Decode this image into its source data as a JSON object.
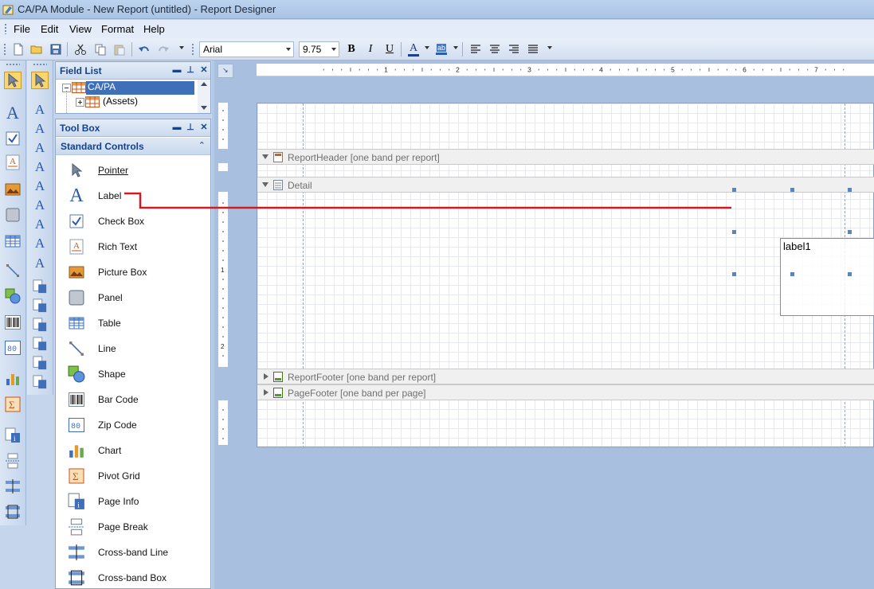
{
  "window": {
    "title": "CA/PA Module - New Report (untitled) - Report Designer"
  },
  "menu": {
    "file": "File",
    "edit": "Edit",
    "view": "View",
    "format": "Format",
    "help": "Help"
  },
  "toolbar": {
    "font_family": "Arial",
    "font_size": "9.75",
    "bold": "B",
    "italic": "I",
    "underline": "U",
    "font_color_glyph": "A",
    "back_color_glyph": "ab"
  },
  "field_list": {
    "title": "Field List",
    "items": [
      {
        "label": "CA/PA",
        "selected": true
      },
      {
        "label": "(Assets)",
        "selected": false
      }
    ]
  },
  "toolbox": {
    "title": "Tool Box",
    "category": "Standard Controls",
    "items": [
      {
        "label": "Pointer",
        "icon": "pointer-icon"
      },
      {
        "label": "Label",
        "icon": "label-icon"
      },
      {
        "label": "Check Box",
        "icon": "checkbox-icon"
      },
      {
        "label": "Rich Text",
        "icon": "rich-text-icon"
      },
      {
        "label": "Picture Box",
        "icon": "picture-icon"
      },
      {
        "label": "Panel",
        "icon": "panel-icon"
      },
      {
        "label": "Table",
        "icon": "table-icon"
      },
      {
        "label": "Line",
        "icon": "line-icon"
      },
      {
        "label": "Shape",
        "icon": "shape-icon"
      },
      {
        "label": "Bar Code",
        "icon": "barcode-icon"
      },
      {
        "label": "Zip Code",
        "icon": "zipcode-icon"
      },
      {
        "label": "Chart",
        "icon": "chart-icon"
      },
      {
        "label": "Pivot Grid",
        "icon": "pivot-grid-icon"
      },
      {
        "label": "Page Info",
        "icon": "page-info-icon"
      },
      {
        "label": "Page Break",
        "icon": "page-break-icon"
      },
      {
        "label": "Cross-band Line",
        "icon": "cross-band-line-icon"
      },
      {
        "label": "Cross-band Box",
        "icon": "cross-band-box-icon"
      }
    ]
  },
  "ruler": {
    "numbers": [
      "1",
      "2",
      "3",
      "4",
      "5",
      "6",
      "7"
    ],
    "vertical_numbers": [
      "1",
      "2"
    ]
  },
  "report": {
    "bands": {
      "report_header": "ReportHeader [one band per report]",
      "detail": "Detail",
      "report_footer": "ReportFooter [one band per report]",
      "page_footer": "PageFooter [one band per page]"
    },
    "selected_control": {
      "text": "label1"
    }
  },
  "colors": {
    "selection": "#3f6fb8",
    "panel_header_text": "#15428b",
    "drag_line": "#d11a22",
    "designer_background": "#a9bfdf"
  }
}
